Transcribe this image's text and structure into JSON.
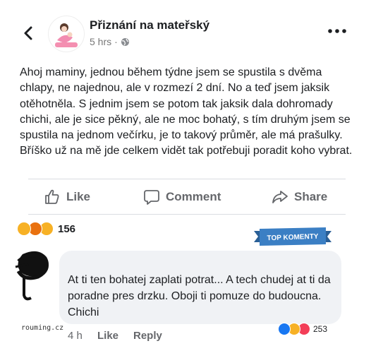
{
  "header": {
    "page_name": "Přiznání na mateřský",
    "time": "5 hrs",
    "dot": "·",
    "icons": [
      "back-arrow-icon",
      "globe-icon",
      "more-options-icon"
    ]
  },
  "post": {
    "text": "Ahoj maminy, jednou během týdne jsem se spustila s dvěma chlapy, ne najednou, ale v rozmezí 2 dní. No a teď jsem jaksik otěhotněla. S jednim jsem se potom tak jaksik dala dohromady chichi, ale je sice pěkný, ale ne moc bohatý, s tím druhým jsem se spustila na jednom večírku, je to takový průměr, ale má prašulky. Bříško už na mě jde celkem vidět tak potřebuji poradit koho vybrat."
  },
  "actions": {
    "like": "Like",
    "comment": "Comment",
    "share": "Share"
  },
  "reactions": {
    "count": "156",
    "types": [
      "haha",
      "angry",
      "wow"
    ]
  },
  "top_comments_badge": "TOP KOMENTY",
  "comment": {
    "text": "At ti ten bohatej zaplati potrat... A tech chudej at ti da poradne pres drzku. Oboji ti pomuze do budoucna. Chichi",
    "time": "4 h",
    "like": "Like",
    "reply": "Reply",
    "reaction_count": "253"
  },
  "watermark": "rouming.cz",
  "colors": {
    "text": "#1c1e21",
    "muted": "#65676b",
    "bubble": "#f0f2f5",
    "badge": "#3b7fc4",
    "like_blue": "#1877f2",
    "love_red": "#f33e58",
    "angry_orange": "#e9710f",
    "haha_yellow": "#f7b125"
  }
}
